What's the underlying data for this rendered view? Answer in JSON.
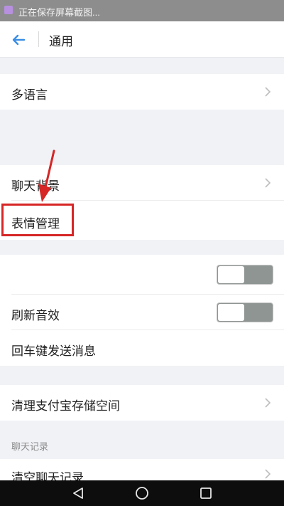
{
  "status_bar": {
    "text": "正在保存屏幕截图..."
  },
  "header": {
    "title": "通用"
  },
  "rows": {
    "language": "多语言",
    "chat_background": "聊天背景",
    "emoji_manage": "表情管理",
    "refresh_sound": "刷新音效",
    "enter_send": "回车键发送消息",
    "clear_storage": "清理支付宝存储空间",
    "clear_chat": "清空聊天记录"
  },
  "toggles": {
    "unlabeled_toggle": false,
    "refresh_sound_toggle": false
  },
  "sections": {
    "chat_records": "聊天记录"
  },
  "icons": {
    "back": "arrow-left-icon",
    "chevron": "chevron-right-icon",
    "nav_back": "triangle-back-icon",
    "nav_home": "circle-home-icon",
    "nav_recent": "square-recent-icon"
  },
  "colors": {
    "accent": "#3a8ee6",
    "highlight": "#d62626",
    "toggle_off": "#8f9593"
  }
}
